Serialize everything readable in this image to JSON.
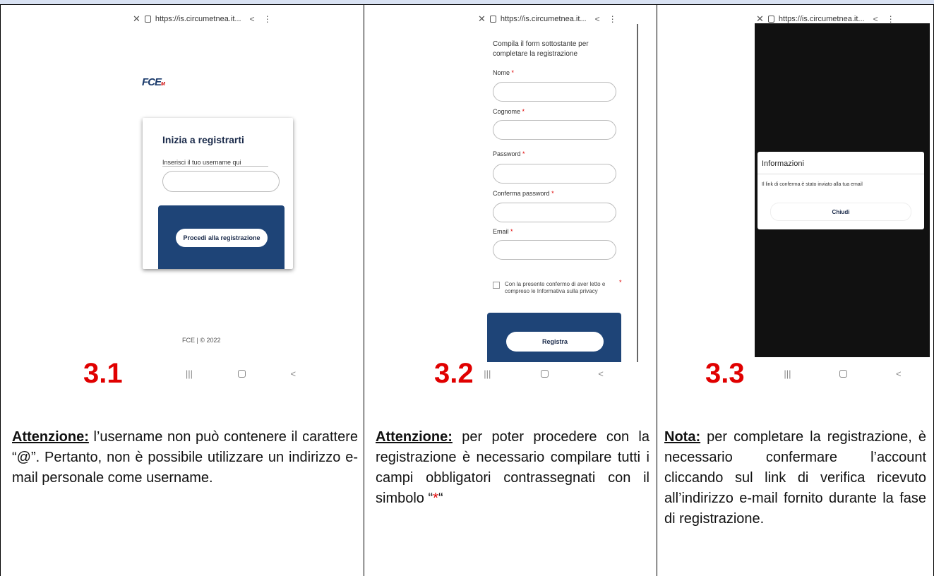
{
  "url_text": "https://is.circumetnea.it...",
  "panel1": {
    "number": "3.1",
    "logo": "FCE",
    "logo_sub": "M",
    "card_title": "Inizia a registrarti",
    "username_label": "Inserisci il tuo username qui",
    "proceed_button": "Procedi alla registrazione",
    "footer": "FCE | © 2022",
    "caption_bold": "Attenzione:",
    "caption_text": " l’username non può contenere il carattere “@”. Pertanto, non è possibile utilizzare un indirizzo e-mail personale come username."
  },
  "panel2": {
    "number": "3.2",
    "intro": "Compila il form sottostante per completare la registrazione",
    "fields": [
      {
        "label": "Nome"
      },
      {
        "label": "Cognome"
      },
      {
        "label": "Password"
      },
      {
        "label": "Conferma password"
      },
      {
        "label": "Email"
      }
    ],
    "required_mark": "*",
    "privacy_text": "Con la presente confermo di aver letto e compreso le Informativa sulla privacy",
    "register_button": "Registra",
    "caption_bold": "Attenzione:",
    "caption_text": " per poter procedere con la registrazione è necessario compilare tutti i campi obbligatori contrassegnati con il simbolo “",
    "caption_star": "*",
    "caption_end": "“"
  },
  "panel3": {
    "number": "3.3",
    "dialog_title": "Informazioni",
    "dialog_message": "Il link di conferma è stato inviato alla tua email",
    "close_button": "Chiudi",
    "caption_bold": "Nota:",
    "caption_text": " per completare la registrazione, è necessario confermare l’account cliccando sul link di verifica ricevuto all’indirizzo e-mail fornito durante la fase di registrazione."
  },
  "nav": {
    "recents": "|||",
    "back": "<"
  },
  "colors": {
    "accent_red": "#e00000",
    "brand_blue": "#1e4477",
    "header_strip": "#d9e2f3"
  }
}
